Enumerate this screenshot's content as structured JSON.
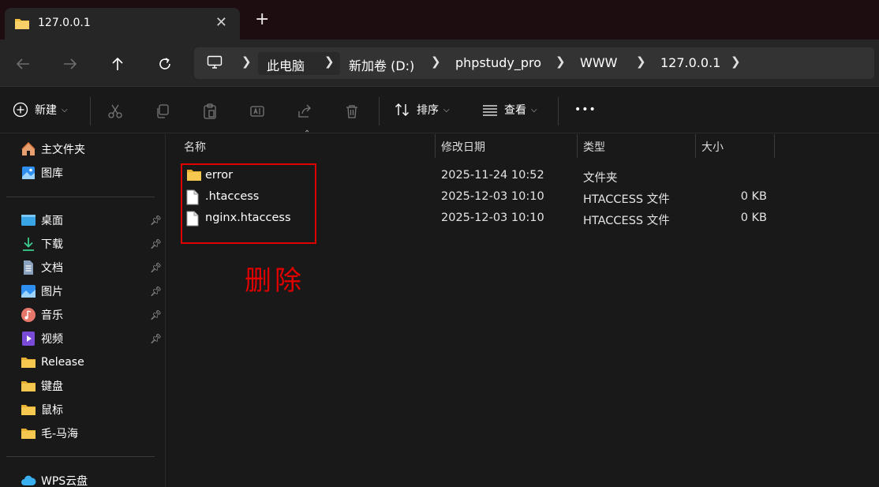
{
  "window": {
    "tab_title": "127.0.0.1",
    "tab_close": "✕",
    "new_tab": "+"
  },
  "nav": {
    "back": "back-arrow",
    "forward": "forward-arrow",
    "up": "up-arrow",
    "refresh": "refresh"
  },
  "address": {
    "segments": [
      "此电脑",
      "新加卷 (D:)",
      "phpstudy_pro",
      "WWW",
      "127.0.0.1"
    ]
  },
  "commands": {
    "new_label": "新建",
    "sort_label": "排序",
    "view_label": "查看",
    "more": "•••"
  },
  "sidebar": {
    "items": [
      {
        "label": "主文件夹",
        "icon": "home-icon",
        "pinned": false
      },
      {
        "label": "图库",
        "icon": "gallery-icon",
        "pinned": false
      },
      {
        "label": "桌面",
        "icon": "desktop-icon",
        "pinned": true
      },
      {
        "label": "下载",
        "icon": "download-icon",
        "pinned": true
      },
      {
        "label": "文档",
        "icon": "document-icon",
        "pinned": true
      },
      {
        "label": "图片",
        "icon": "pictures-icon",
        "pinned": true
      },
      {
        "label": "音乐",
        "icon": "music-icon",
        "pinned": true
      },
      {
        "label": "视频",
        "icon": "video-icon",
        "pinned": true
      },
      {
        "label": "Release",
        "icon": "folder-icon",
        "pinned": false
      },
      {
        "label": "键盘",
        "icon": "folder-icon",
        "pinned": false
      },
      {
        "label": "鼠标",
        "icon": "folder-icon",
        "pinned": false
      },
      {
        "label": "毛-马海",
        "icon": "folder-icon",
        "pinned": false
      },
      {
        "label": "WPS云盘",
        "icon": "cloud-icon",
        "pinned": false
      }
    ]
  },
  "table": {
    "columns": [
      "名称",
      "修改日期",
      "类型",
      "大小"
    ],
    "rows": [
      {
        "name": "error",
        "modified": "2025-11-24 10:52",
        "type": "文件夹",
        "size": "",
        "icon": "folder-icon"
      },
      {
        "name": ".htaccess",
        "modified": "2025-12-03 10:10",
        "type": "HTACCESS 文件",
        "size": "0 KB",
        "icon": "file-icon"
      },
      {
        "name": "nginx.htaccess",
        "modified": "2025-12-03 10:10",
        "type": "HTACCESS 文件",
        "size": "0 KB",
        "icon": "file-icon"
      }
    ]
  },
  "annotation": {
    "text": "删除",
    "color": "#e00000"
  },
  "colors": {
    "folder": "#f4c042",
    "accent": "#e00000"
  }
}
